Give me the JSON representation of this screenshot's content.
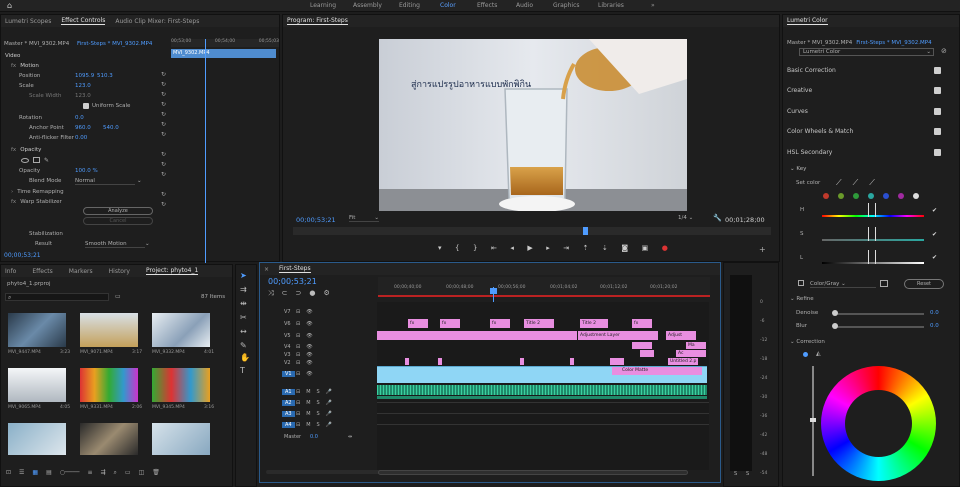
{
  "workspaces": [
    "Learning",
    "Assembly",
    "Editing",
    "Color",
    "Effects",
    "Audio",
    "Graphics",
    "Libraries"
  ],
  "workspace_active": "Color",
  "more_symbol": "»",
  "ec": {
    "tabs": [
      "Lumetri Scopes",
      "Effect Controls",
      "Audio Clip Mixer: First-Steps"
    ],
    "master": "Master * MVI_9302.MP4",
    "sequence": "First-Steps * MVI_9302.MP4",
    "tl_times": [
      "00;53;00",
      "00;54;00",
      "00;55;03"
    ],
    "clip_name": "MVI_9302.MP4",
    "video_label": "Video",
    "motion": "Motion",
    "position_label": "Position",
    "position_x": "1095.9",
    "position_y": "510.3",
    "scale_label": "Scale",
    "scale_val": "123.0",
    "scale_width_label": "Scale Width",
    "scale_width_val": "123.0",
    "uniform": "Uniform Scale",
    "rotation_label": "Rotation",
    "rotation_val": "0.0",
    "anchor_label": "Anchor Point",
    "anchor_x": "960.0",
    "anchor_y": "540.0",
    "flicker_label": "Anti-flicker Filter",
    "flicker_val": "0.00",
    "opacity": "Opacity",
    "opacity_label": "Opacity",
    "opacity_val": "100.0 %",
    "blend_label": "Blend Mode",
    "blend_val": "Normal",
    "time_remap": "Time Remapping",
    "warp": "Warp Stabilizer",
    "analyze": "Analyze",
    "cancel": "Cancel",
    "stabilization": "Stabilization",
    "result_label": "Result",
    "result_val": "Smooth Motion",
    "timecode": "00;00;53;21"
  },
  "program": {
    "title": "Program: First-Steps",
    "caption": "สู่การแปรรูปอาหารแบบพักพิกิน",
    "timecode": "00;00;53;21",
    "fit": "Fit",
    "quality": "1/4",
    "duration": "00;01;28;00"
  },
  "project": {
    "tabs": [
      "Info",
      "Effects",
      "Markers",
      "History",
      "Project: phyto4_1"
    ],
    "file": "phyto4_1.prproj",
    "count": "87 Items",
    "items": [
      {
        "name": "MVI_9447.MP4",
        "dur": "3:23"
      },
      {
        "name": "MVI_9071.MP4",
        "dur": "3:17"
      },
      {
        "name": "MVI_9332.MP4",
        "dur": "4:01"
      },
      {
        "name": "MVI_9065.MP4",
        "dur": "4:05"
      },
      {
        "name": "MVI_9331.MP4",
        "dur": "2:06"
      },
      {
        "name": "MVI_9345.MP4",
        "dur": "3:16"
      },
      {
        "name": "",
        "dur": ""
      },
      {
        "name": "",
        "dur": ""
      },
      {
        "name": "",
        "dur": ""
      }
    ]
  },
  "timeline": {
    "tab": "First-Steps",
    "timecode": "00;00;53;21",
    "ruler": [
      "00;00;40;00",
      "00;00;48;00",
      "00;00;56;00",
      "00;01;04;02",
      "00;01;12;02",
      "00;01;20;02"
    ],
    "video_tracks": [
      "V7",
      "V6",
      "V5",
      "V4",
      "V3",
      "V2",
      "V1"
    ],
    "audio_tracks": [
      "A1",
      "A2",
      "A3",
      "A4"
    ],
    "master": "Master",
    "master_val": "0.0",
    "clips": {
      "title2": "Title 2",
      "title2b": "Title 2",
      "adjustment": "Adjustment Layer",
      "adjust": "Adjust",
      "ma": "Ma",
      "ac": "Ac",
      "untitled": "Untitled 2.p",
      "color_matte": "Color Matte"
    },
    "meter_ticks": [
      "0",
      "-6",
      "-12",
      "-18",
      "-24",
      "-30",
      "-36",
      "-42",
      "-48",
      "-54"
    ],
    "meter_s": [
      "S",
      "S"
    ]
  },
  "lumetri": {
    "title": "Lumetri Color",
    "master": "Master * MVI_9302.MP4",
    "sequence": "First-Steps * MVI_9302.MP4",
    "preset": "Lumetri Color",
    "sections": [
      "Basic Correction",
      "Creative",
      "Curves",
      "Color Wheels & Match",
      "HSL Secondary"
    ],
    "key": "Key",
    "set_color": "Set color",
    "h": "H",
    "s": "S",
    "l": "L",
    "color_gray": "Color/Gray",
    "reset": "Reset",
    "refine": "Refine",
    "denoise": "Denoise",
    "denoise_val": "0.0",
    "blur": "Blur",
    "blur_val": "0.0",
    "correction": "Correction",
    "swatch_colors": [
      "#c0392b",
      "#6a9a2a",
      "#2e9a3a",
      "#2aa7a0",
      "#2a4fd0",
      "#a02aa0",
      "#dddddd"
    ]
  },
  "colors": {
    "accent": "#4f9cff",
    "playhead": "#4f9cff",
    "clip_cyan": "#8fd6f5",
    "clip_pink": "#e88ee0",
    "clip_green": "#1f8a6a"
  }
}
